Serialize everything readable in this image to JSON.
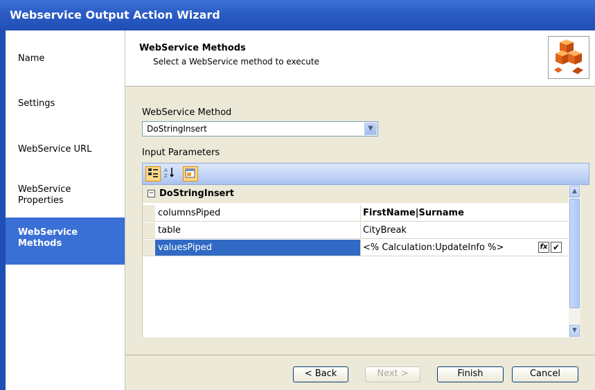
{
  "window": {
    "title": "Webservice Output Action Wizard"
  },
  "steps": [
    {
      "label": "Name",
      "active": false
    },
    {
      "label": "Settings",
      "active": false
    },
    {
      "label": "WebService URL",
      "active": false
    },
    {
      "label": "WebService Properties",
      "active": false
    },
    {
      "label": "WebService Methods",
      "active": true
    }
  ],
  "header": {
    "title": "WebService Methods",
    "subtitle": "Select a WebService method to execute",
    "logo_icon": "orange-cubes-icon"
  },
  "method": {
    "label": "WebService Method",
    "selected": "DoStringInsert"
  },
  "params": {
    "label": "Input Parameters",
    "toolbar": [
      "categorized-icon",
      "alphabetical-icon",
      "property-pages-icon"
    ],
    "category": "DoStringInsert",
    "rows": [
      {
        "name": "columnsPiped",
        "value": "FirstName|Surname",
        "bold": true
      },
      {
        "name": "table",
        "value": "CityBreak",
        "bold": false
      },
      {
        "name": "valuesPiped",
        "value": "<% Calculation:UpdateInfo %>",
        "bold": false,
        "selected": true
      }
    ]
  },
  "buttons": {
    "back": "< Back",
    "next": "Next >",
    "finish": "Finish",
    "cancel": "Cancel"
  },
  "colors": {
    "title_bar": "#2a5cc4",
    "active_step": "#3a6fd6",
    "selection": "#316ac5"
  }
}
